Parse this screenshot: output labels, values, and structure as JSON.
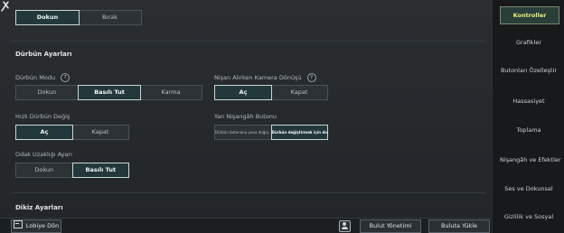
{
  "top_toggle": {
    "options": [
      "Dokun",
      "Bırak"
    ],
    "selected": 0
  },
  "sections": {
    "scope_settings": "Dürbün Ayarları",
    "tilt_settings": "Dikiz Ayarları"
  },
  "scope_mode": {
    "label": "Dürbün Modu",
    "options": [
      "Dokun",
      "Basılı Tut",
      "Karma"
    ],
    "selected": 1
  },
  "camera_rotation": {
    "label": "Nişan Alırken Kamera Dönüşü",
    "options": [
      "Aç",
      "Kapat"
    ],
    "selected": 0
  },
  "quick_scope_switch": {
    "label": "Hızlı Dürbün Değiş",
    "options": [
      "Aç",
      "Kapat"
    ],
    "selected": 0
  },
  "side_aim_button": {
    "label": "Yan Nişangâh Butonu",
    "options": [
      "Dürbün butonunu yana doğru...",
      "Dürbün değiştirmek için dokun"
    ],
    "selected": 1
  },
  "focal_length": {
    "label": "Odak Uzaklığı Ayarı",
    "options": [
      "Dokun",
      "Basılı Tut"
    ],
    "selected": 1
  },
  "bottom": {
    "lobby_button": "Lobiye Dön",
    "cloud_manage": "Bulut Yönetimi",
    "cloud_upload": "Buluta Yükle"
  },
  "sidebar": {
    "items": [
      "Kontroller",
      "Grafikler",
      "Butonları Özelleştir",
      "Hassasiyet",
      "Toplama",
      "Nişangâh ve Efektler",
      "Ses ve Dokunsal",
      "Gizlilik ve Sosyal"
    ],
    "active": 0
  }
}
